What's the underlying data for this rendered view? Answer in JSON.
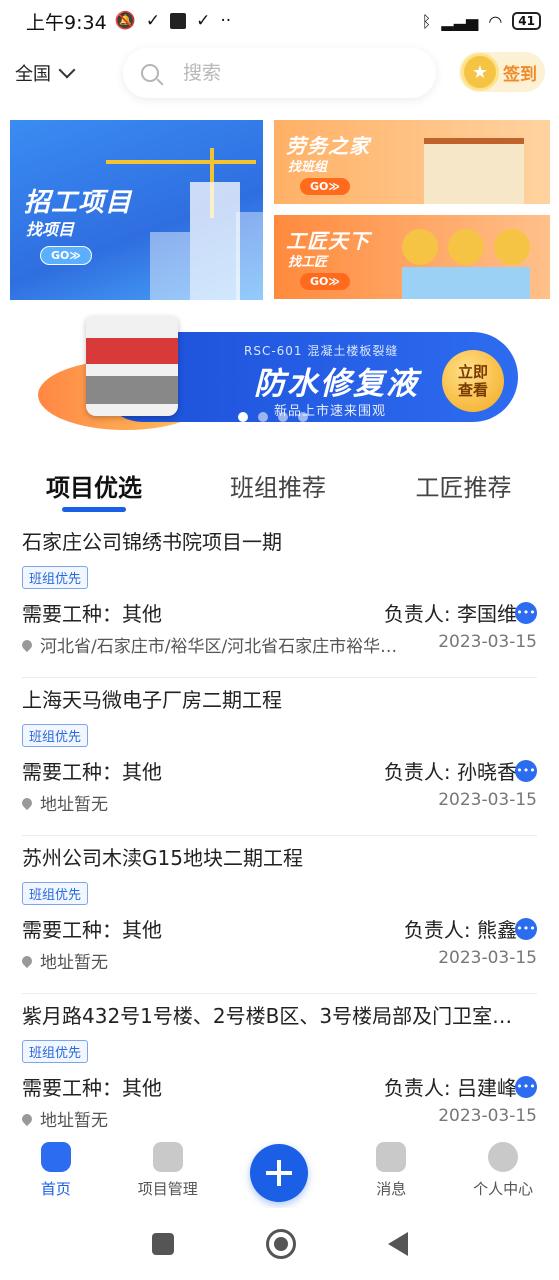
{
  "status_bar": {
    "time": "上午9:34",
    "battery": "41"
  },
  "header": {
    "region_label": "全国",
    "search_placeholder": "搜索",
    "signin_label": "签到"
  },
  "banners": {
    "main": {
      "title": "招工项目",
      "subtitle": "找项目",
      "go": "GO≫"
    },
    "side1": {
      "title": "劳务之家",
      "subtitle": "找班组",
      "go": "GO≫"
    },
    "side2": {
      "title": "工匠天下",
      "subtitle": "找工匠",
      "go": "GO≫"
    }
  },
  "promo": {
    "model": "RSC-601 混凝土楼板裂缝",
    "headline": "防水修复液",
    "tagline": "新品上市速来围观",
    "cta": "立即查看"
  },
  "tabs": [
    {
      "label": "项目优选",
      "active": true
    },
    {
      "label": "班组推荐",
      "active": false
    },
    {
      "label": "工匠推荐",
      "active": false
    }
  ],
  "projects": [
    {
      "title": "石家庄公司锦绣书院项目一期",
      "tag": "班组优先",
      "work_type": "需要工种：其他",
      "owner": "负责人: 李国维",
      "address": "河北省/石家庄市/裕华区/河北省石家庄市裕华…",
      "date": "2023-03-15"
    },
    {
      "title": "上海天马微电子厂房二期工程",
      "tag": "班组优先",
      "work_type": "需要工种：其他",
      "owner": "负责人: 孙晓香",
      "address": "地址暂无",
      "date": "2023-03-15"
    },
    {
      "title": "苏州公司木渎G15地块二期工程",
      "tag": "班组优先",
      "work_type": "需要工种：其他",
      "owner": "负责人: 熊鑫",
      "address": "地址暂无",
      "date": "2023-03-15"
    },
    {
      "title": "紫月路432号1号楼、2号楼B区、3号楼局部及门卫室…",
      "tag": "班组优先",
      "work_type": "需要工种：其他",
      "owner": "负责人: 吕建峰",
      "address": "地址暂无",
      "date": "2023-03-15"
    }
  ],
  "bottom_nav": [
    {
      "label": "首页",
      "active": true
    },
    {
      "label": "项目管理",
      "active": false
    },
    {
      "label": "",
      "active": false
    },
    {
      "label": "消息",
      "active": false
    },
    {
      "label": "个人中心",
      "active": false
    }
  ],
  "colors": {
    "primary": "#1a5fe6",
    "accent_orange": "#f08b2a"
  }
}
